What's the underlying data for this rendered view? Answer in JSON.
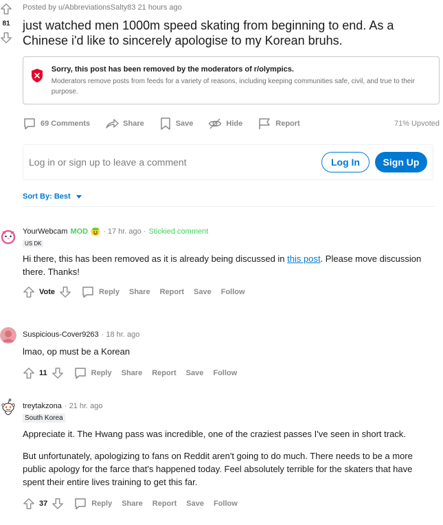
{
  "post": {
    "score": "81",
    "posted_by": "Posted by u/AbbreviationsSalty83 21 hours ago",
    "title": "just watched men 1000m speed skating from beginning to end. As a Chinese i'd like to sincerely apologise to my Korean bruhs.",
    "removed_title": "Sorry, this post has been removed by the moderators of r/olympics.",
    "removed_desc": "Moderators remove posts from feeds for a variety of reasons, including keeping communities safe, civil, and true to their purpose.",
    "actions": {
      "comments": "69 Comments",
      "share": "Share",
      "save": "Save",
      "hide": "Hide",
      "report": "Report",
      "upvoted": "71% Upvoted"
    }
  },
  "login": {
    "prompt": "Log in or sign up to leave a comment",
    "login_label": "Log In",
    "signup_label": "Sign Up"
  },
  "sort": {
    "label": "Sort By: Best"
  },
  "comments": [
    {
      "author": "YourWebcam",
      "mod": "MOD",
      "time": "· 17 hr. ago ·",
      "sticky": "Stickied comment",
      "flair": "US DK",
      "text_before": "Hi there, this has been removed as it is already being discussed in ",
      "link": "this post",
      "text_after": ". Please move discussion there. Thanks!",
      "vote": "Vote",
      "reply": "Reply",
      "share": "Share",
      "report": "Report",
      "save": "Save",
      "follow": "Follow"
    },
    {
      "author": "Suspicious-Cover9263",
      "time": "· 18 hr. ago",
      "text": "lmao, op must be a Korean",
      "vote": "11",
      "reply": "Reply",
      "share": "Share",
      "report": "Report",
      "save": "Save",
      "follow": "Follow"
    },
    {
      "author": "treytakzona",
      "time": "· 21 hr. ago",
      "flair": "South Korea",
      "p1": "Appreciate it. The Hwang pass was incredible, one of the craziest passes I've seen in short track.",
      "p2": "But unfortunately, apologizing to fans on Reddit aren't going to do much. There needs to be a more public apology for the farce that's happened today. Feel absolutely terrible for the skaters that have spent their entire lives training to get this far.",
      "vote": "37",
      "reply": "Reply",
      "share": "Share",
      "report": "Report",
      "save": "Save",
      "follow": "Follow"
    }
  ],
  "colors": {
    "accent": "#0079d3",
    "mod_green": "#46d160",
    "removed_red": "#ea0027",
    "muted": "#878a8c"
  }
}
